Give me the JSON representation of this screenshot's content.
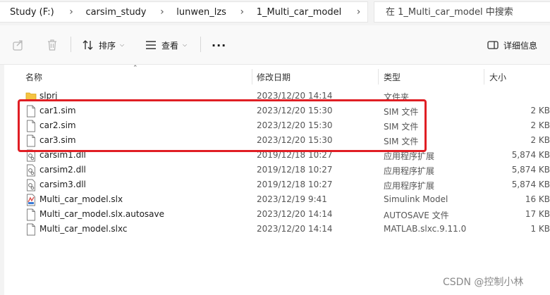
{
  "breadcrumb": [
    {
      "label": "Study (F:)"
    },
    {
      "label": "carsim_study"
    },
    {
      "label": "lunwen_lzs"
    },
    {
      "label": "1_Multi_car_model"
    }
  ],
  "search": {
    "placeholder": "在 1_Multi_car_model 中搜索"
  },
  "toolbar": {
    "sort_label": "排序",
    "view_label": "查看",
    "more_label": "···",
    "details_label": "详细信息"
  },
  "columns": {
    "name": "名称",
    "date": "修改日期",
    "type": "类型",
    "size": "大小"
  },
  "files": [
    {
      "name": "slprj",
      "date": "2023/12/20 14:14",
      "type": "文件夹",
      "size": "",
      "icon": "folder-icon"
    },
    {
      "name": "car1.sim",
      "date": "2023/12/20 15:30",
      "type": "SIM 文件",
      "size": "2 KB",
      "icon": "file-icon"
    },
    {
      "name": "car2.sim",
      "date": "2023/12/20 15:30",
      "type": "SIM 文件",
      "size": "2 KB",
      "icon": "file-icon"
    },
    {
      "name": "car3.sim",
      "date": "2023/12/20 15:30",
      "type": "SIM 文件",
      "size": "2 KB",
      "icon": "file-icon"
    },
    {
      "name": "carsim1.dll",
      "date": "2019/12/18 10:27",
      "type": "应用程序扩展",
      "size": "5,874 KB",
      "icon": "dll-icon"
    },
    {
      "name": "carsim2.dll",
      "date": "2019/12/18 10:27",
      "type": "应用程序扩展",
      "size": "5,874 KB",
      "icon": "dll-icon"
    },
    {
      "name": "carsim3.dll",
      "date": "2019/12/18 10:27",
      "type": "应用程序扩展",
      "size": "5,874 KB",
      "icon": "dll-icon"
    },
    {
      "name": "Multi_car_model.slx",
      "date": "2023/12/19 9:41",
      "type": "Simulink Model",
      "size": "16 KB",
      "icon": "simulink-icon"
    },
    {
      "name": "Multi_car_model.slx.autosave",
      "date": "2023/12/20 14:14",
      "type": "AUTOSAVE 文件",
      "size": "17 KB",
      "icon": "file-icon"
    },
    {
      "name": "Multi_car_model.slxc",
      "date": "2023/12/20 14:14",
      "type": "MATLAB.slxc.9.11.0",
      "size": "1 KB",
      "icon": "file-icon"
    }
  ],
  "watermark": "CSDN @控制小林",
  "colors": {
    "highlight": "#e01e24",
    "folder": "#f5c342",
    "accent": "#0067c0"
  }
}
